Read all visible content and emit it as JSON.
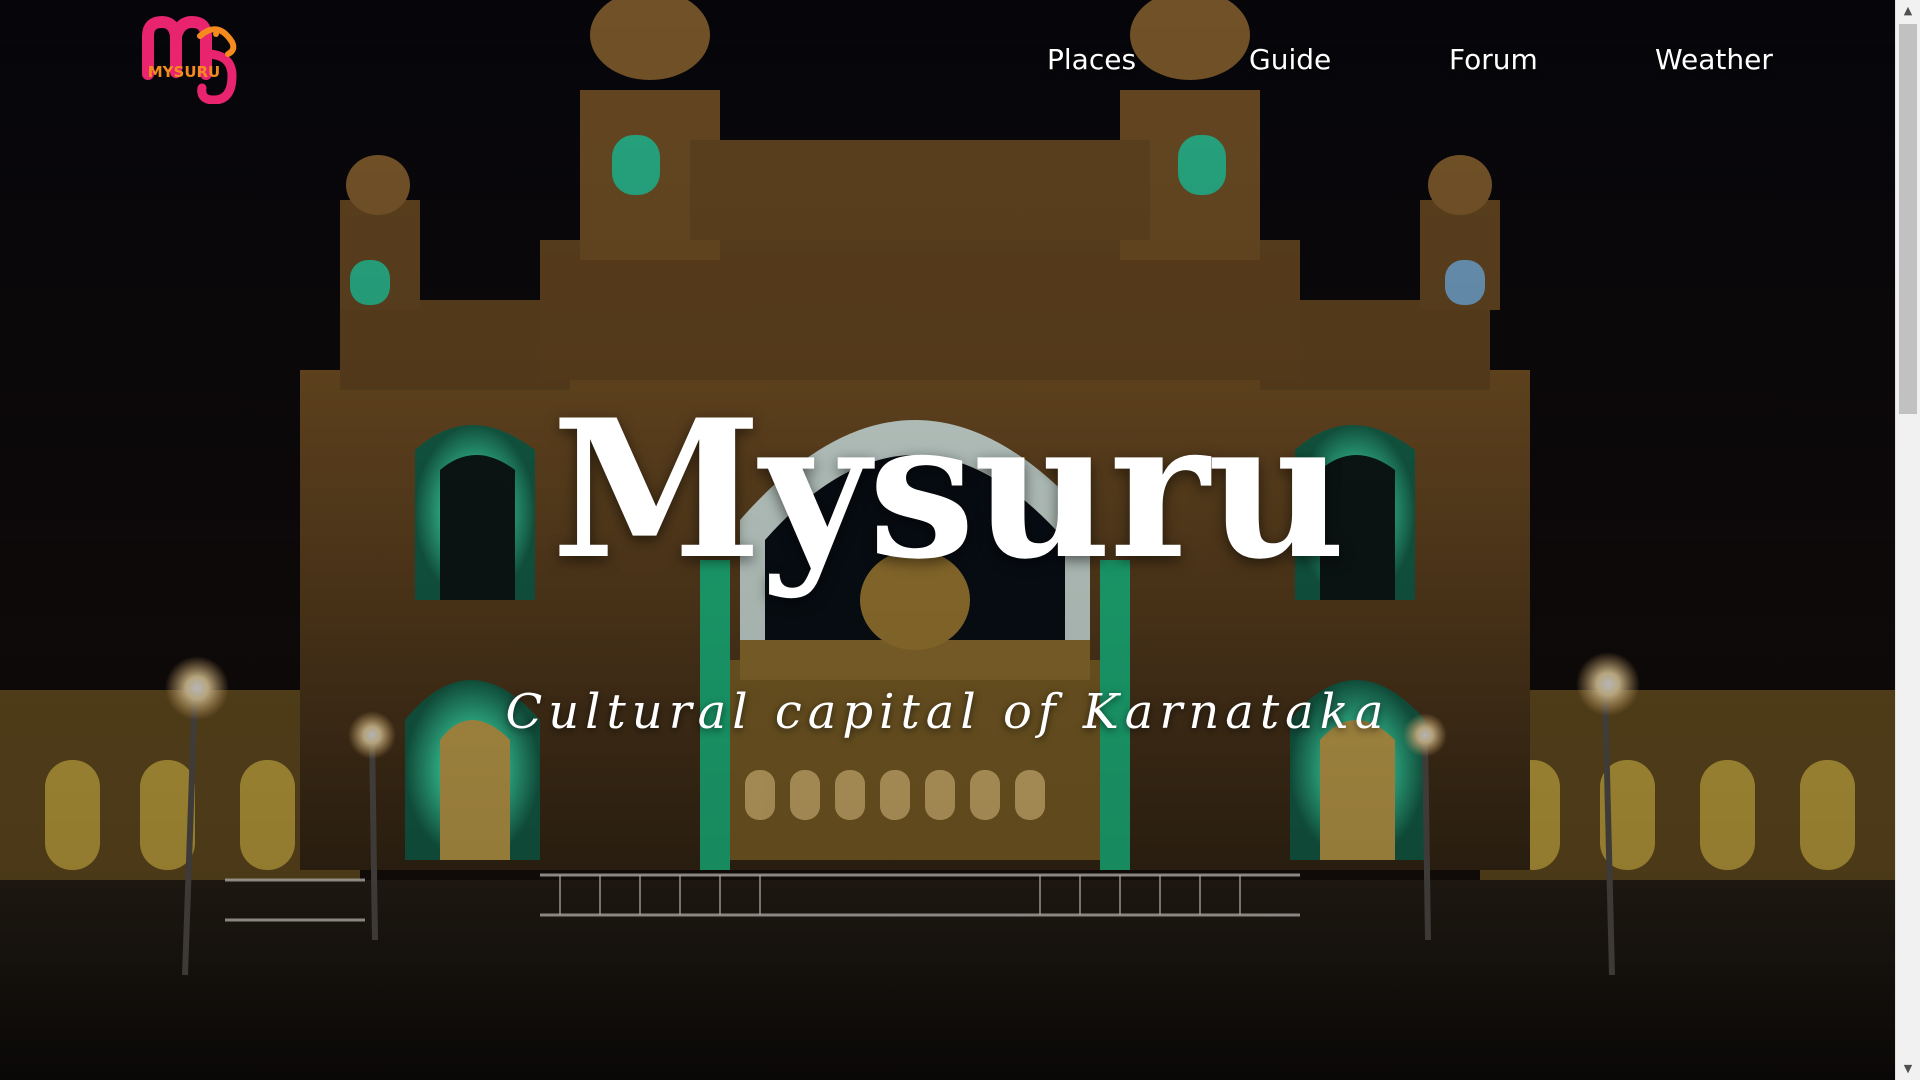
{
  "logo": {
    "text": "MYSURU"
  },
  "nav": {
    "items": [
      {
        "label": "Places"
      },
      {
        "label": "Guide"
      },
      {
        "label": "Forum"
      },
      {
        "label": "Weather"
      }
    ]
  },
  "hero": {
    "title": "Mysuru",
    "subtitle": "Cultural capital of Karnataka",
    "background": "palace-night-image"
  },
  "colors": {
    "logo_pink": "#e8246f",
    "logo_orange": "#f58a1f",
    "accent_green": "#3ee6b0",
    "sky": "#0b0a12"
  },
  "scrollbar": {
    "up_icon": "triangle-up-icon",
    "down_icon": "triangle-down-icon"
  }
}
